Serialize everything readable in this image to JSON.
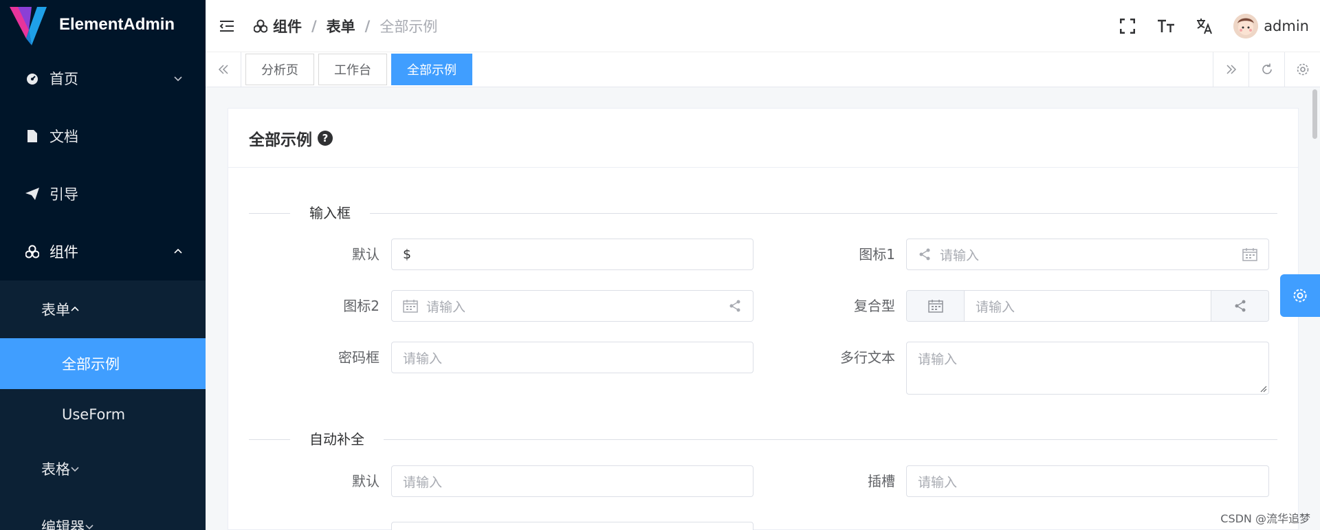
{
  "app": {
    "name": "ElementAdmin"
  },
  "sidebar": {
    "items": [
      {
        "label": "首页",
        "icon": "dashboard-icon",
        "arrow": "down"
      },
      {
        "label": "文档",
        "icon": "file-icon"
      },
      {
        "label": "引导",
        "icon": "send-icon"
      },
      {
        "label": "组件",
        "icon": "cubes-icon",
        "arrow": "up"
      }
    ],
    "submenu": {
      "form": {
        "label": "表单",
        "children": [
          "全部示例",
          "UseForm"
        ]
      },
      "table": {
        "label": "表格"
      },
      "editor": {
        "label": "编辑器"
      }
    }
  },
  "header": {
    "breadcrumb": [
      "组件",
      "表单",
      "全部示例"
    ],
    "username": "admin"
  },
  "tags": [
    "分析页",
    "工作台",
    "全部示例"
  ],
  "card": {
    "title": "全部示例",
    "sections": {
      "input": "输入框",
      "autocomplete": "自动补全"
    },
    "fields": {
      "default_label": "默认",
      "default_value": "$",
      "icon1_label": "图标1",
      "icon2_label": "图标2",
      "compound_label": "复合型",
      "password_label": "密码框",
      "textarea_label": "多行文本",
      "ac_default_label": "默认",
      "ac_slot_label": "插槽",
      "placeholder": "请输入"
    }
  },
  "watermark": "CSDN @流华追梦",
  "colors": {
    "sidebar": "#001529",
    "accent": "#409eff"
  }
}
